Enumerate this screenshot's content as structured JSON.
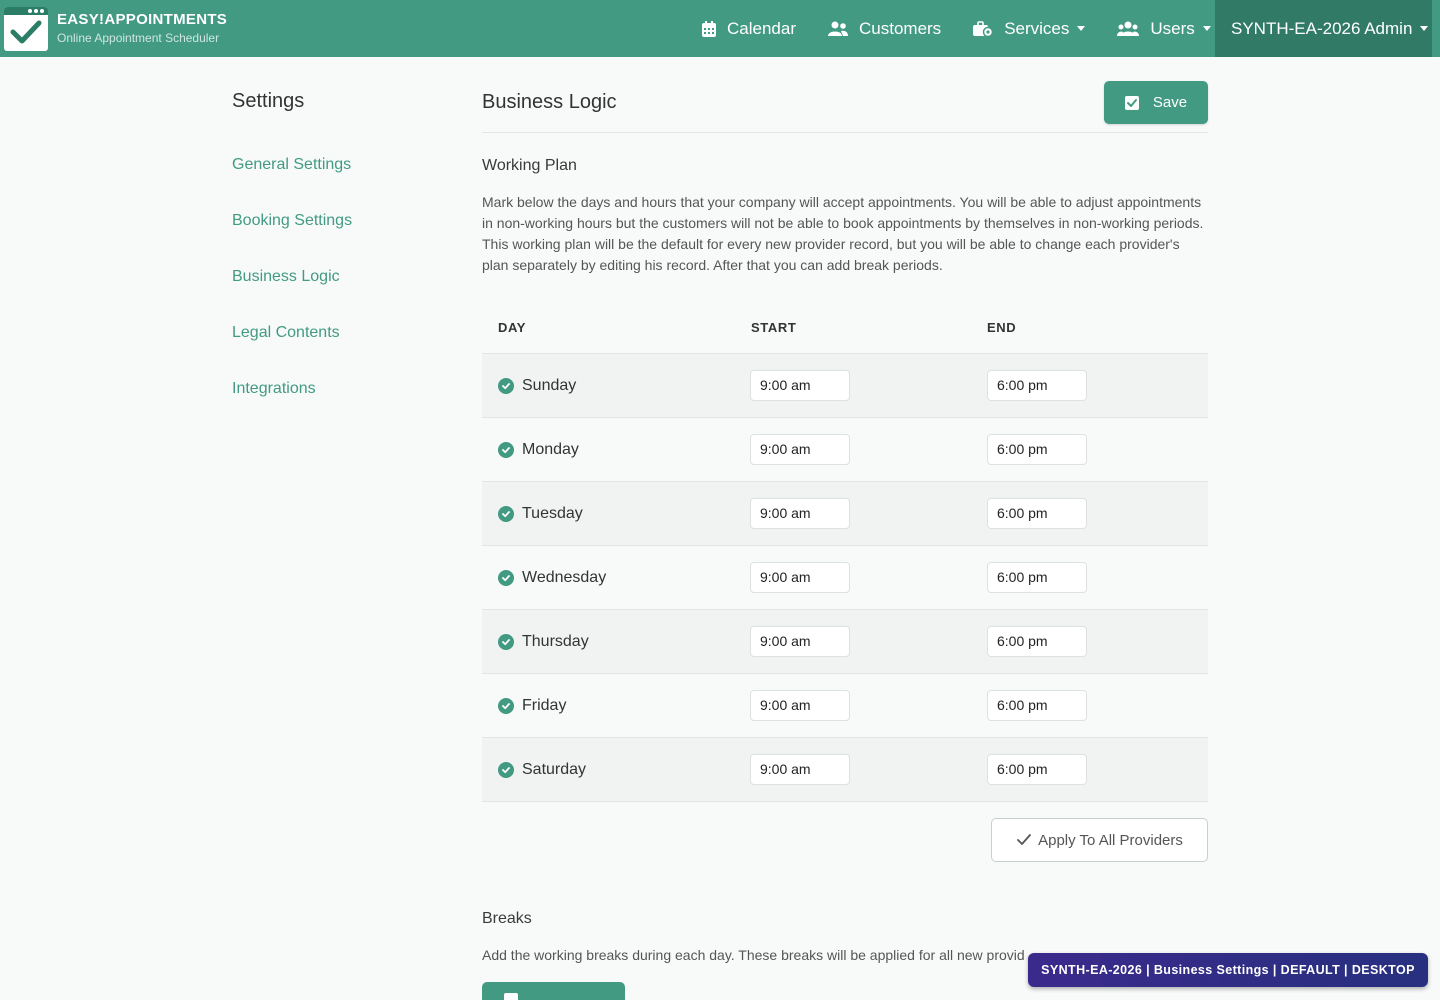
{
  "brand": {
    "title": "EASY!APPOINTMENTS",
    "subtitle": "Online Appointment Scheduler"
  },
  "nav": {
    "calendar": "Calendar",
    "customers": "Customers",
    "services": "Services",
    "users": "Users",
    "admin": "SYNTH-EA-2026 Admin"
  },
  "sidebar": {
    "title": "Settings",
    "items": [
      {
        "label": "General Settings"
      },
      {
        "label": "Booking Settings"
      },
      {
        "label": "Business Logic"
      },
      {
        "label": "Legal Contents"
      },
      {
        "label": "Integrations"
      }
    ]
  },
  "main": {
    "title": "Business Logic",
    "save_label": "Save",
    "working_plan": {
      "title": "Working Plan",
      "description": "Mark below the days and hours that your company will accept appointments. You will be able to adjust appointments in non-working hours but the customers will not be able to book appointments by themselves in non-working periods. This working plan will be the default for every new provider record, but you will be able to change each provider's plan separately by editing his record. After that you can add break periods."
    },
    "table": {
      "headers": {
        "day": "DAY",
        "start": "START",
        "end": "END"
      },
      "rows": [
        {
          "day": "Sunday",
          "checked": true,
          "start": "9:00 am",
          "end": "6:00 pm"
        },
        {
          "day": "Monday",
          "checked": true,
          "start": "9:00 am",
          "end": "6:00 pm"
        },
        {
          "day": "Tuesday",
          "checked": true,
          "start": "9:00 am",
          "end": "6:00 pm"
        },
        {
          "day": "Wednesday",
          "checked": true,
          "start": "9:00 am",
          "end": "6:00 pm"
        },
        {
          "day": "Thursday",
          "checked": true,
          "start": "9:00 am",
          "end": "6:00 pm"
        },
        {
          "day": "Friday",
          "checked": true,
          "start": "9:00 am",
          "end": "6:00 pm"
        },
        {
          "day": "Saturday",
          "checked": true,
          "start": "9:00 am",
          "end": "6:00 pm"
        }
      ]
    },
    "apply_label": "Apply To All Providers",
    "breaks": {
      "title": "Breaks",
      "description": "Add the working breaks during each day. These breaks will be applied for all new provid"
    }
  },
  "env_badge": "SYNTH-EA-2026 | Business Settings | DEFAULT | DESKTOP",
  "colors": {
    "accent": "#429a82",
    "header": "#429a82",
    "admin_bg": "#317a66",
    "badge_bg": "#2f2d86"
  }
}
